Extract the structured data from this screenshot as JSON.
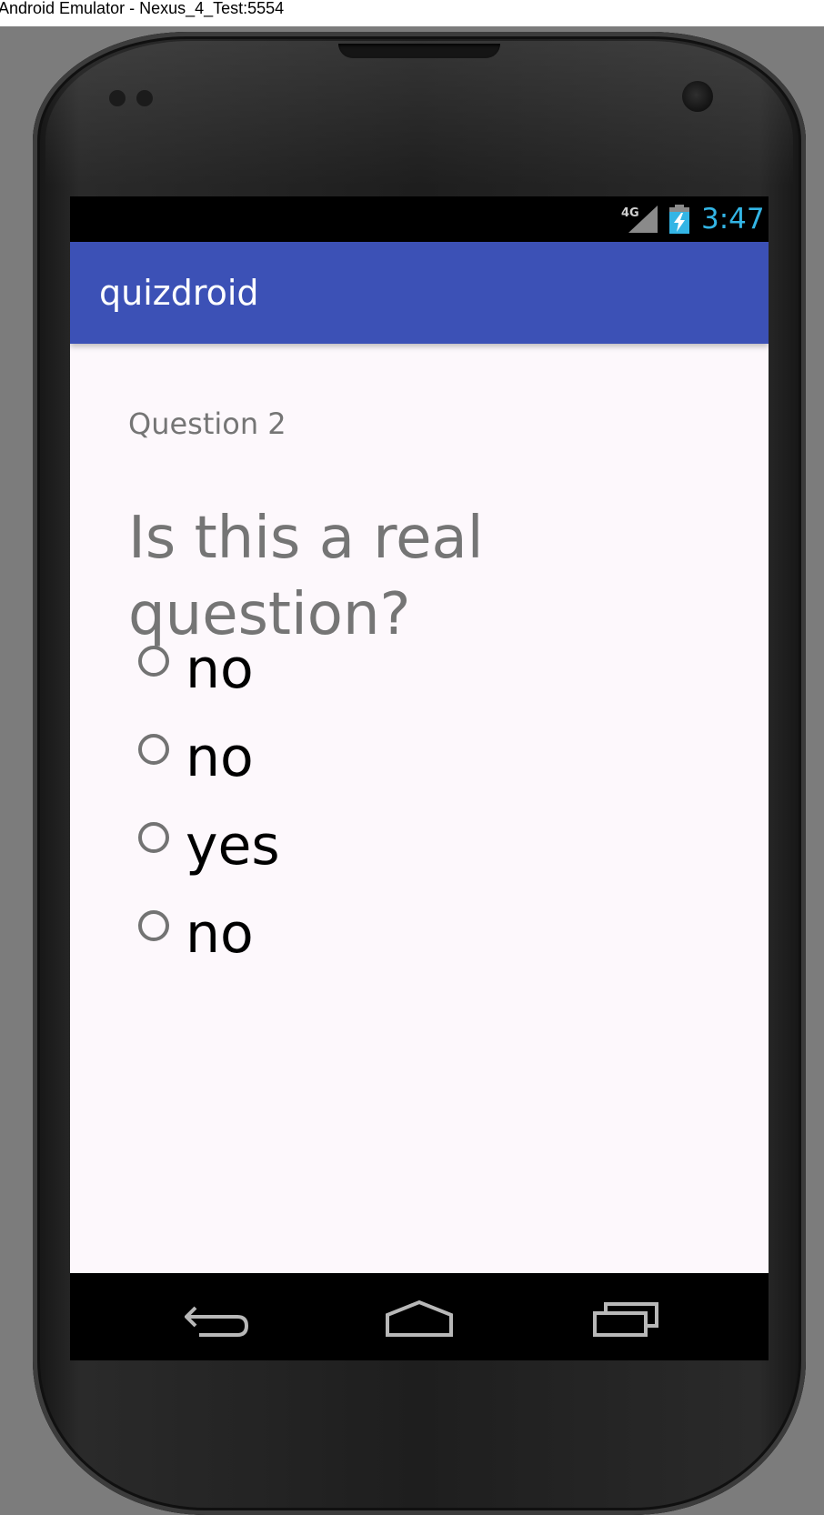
{
  "window": {
    "title": "Android Emulator - Nexus_4_Test:5554"
  },
  "status_bar": {
    "network_label": "4G",
    "time": "3:47",
    "clock_color": "#33b5e5",
    "icons": [
      "signal-4g-icon",
      "battery-charging-icon"
    ]
  },
  "app_bar": {
    "title": "quizdroid",
    "color": "#3c51b6"
  },
  "question": {
    "number_label": "Question 2",
    "text": "Is this a real question?",
    "options": [
      {
        "label": "no",
        "selected": false
      },
      {
        "label": "no",
        "selected": false
      },
      {
        "label": "yes",
        "selected": false
      },
      {
        "label": "no",
        "selected": false
      }
    ]
  },
  "nav_bar": {
    "icons": [
      "back-icon",
      "home-icon",
      "recents-icon"
    ]
  }
}
